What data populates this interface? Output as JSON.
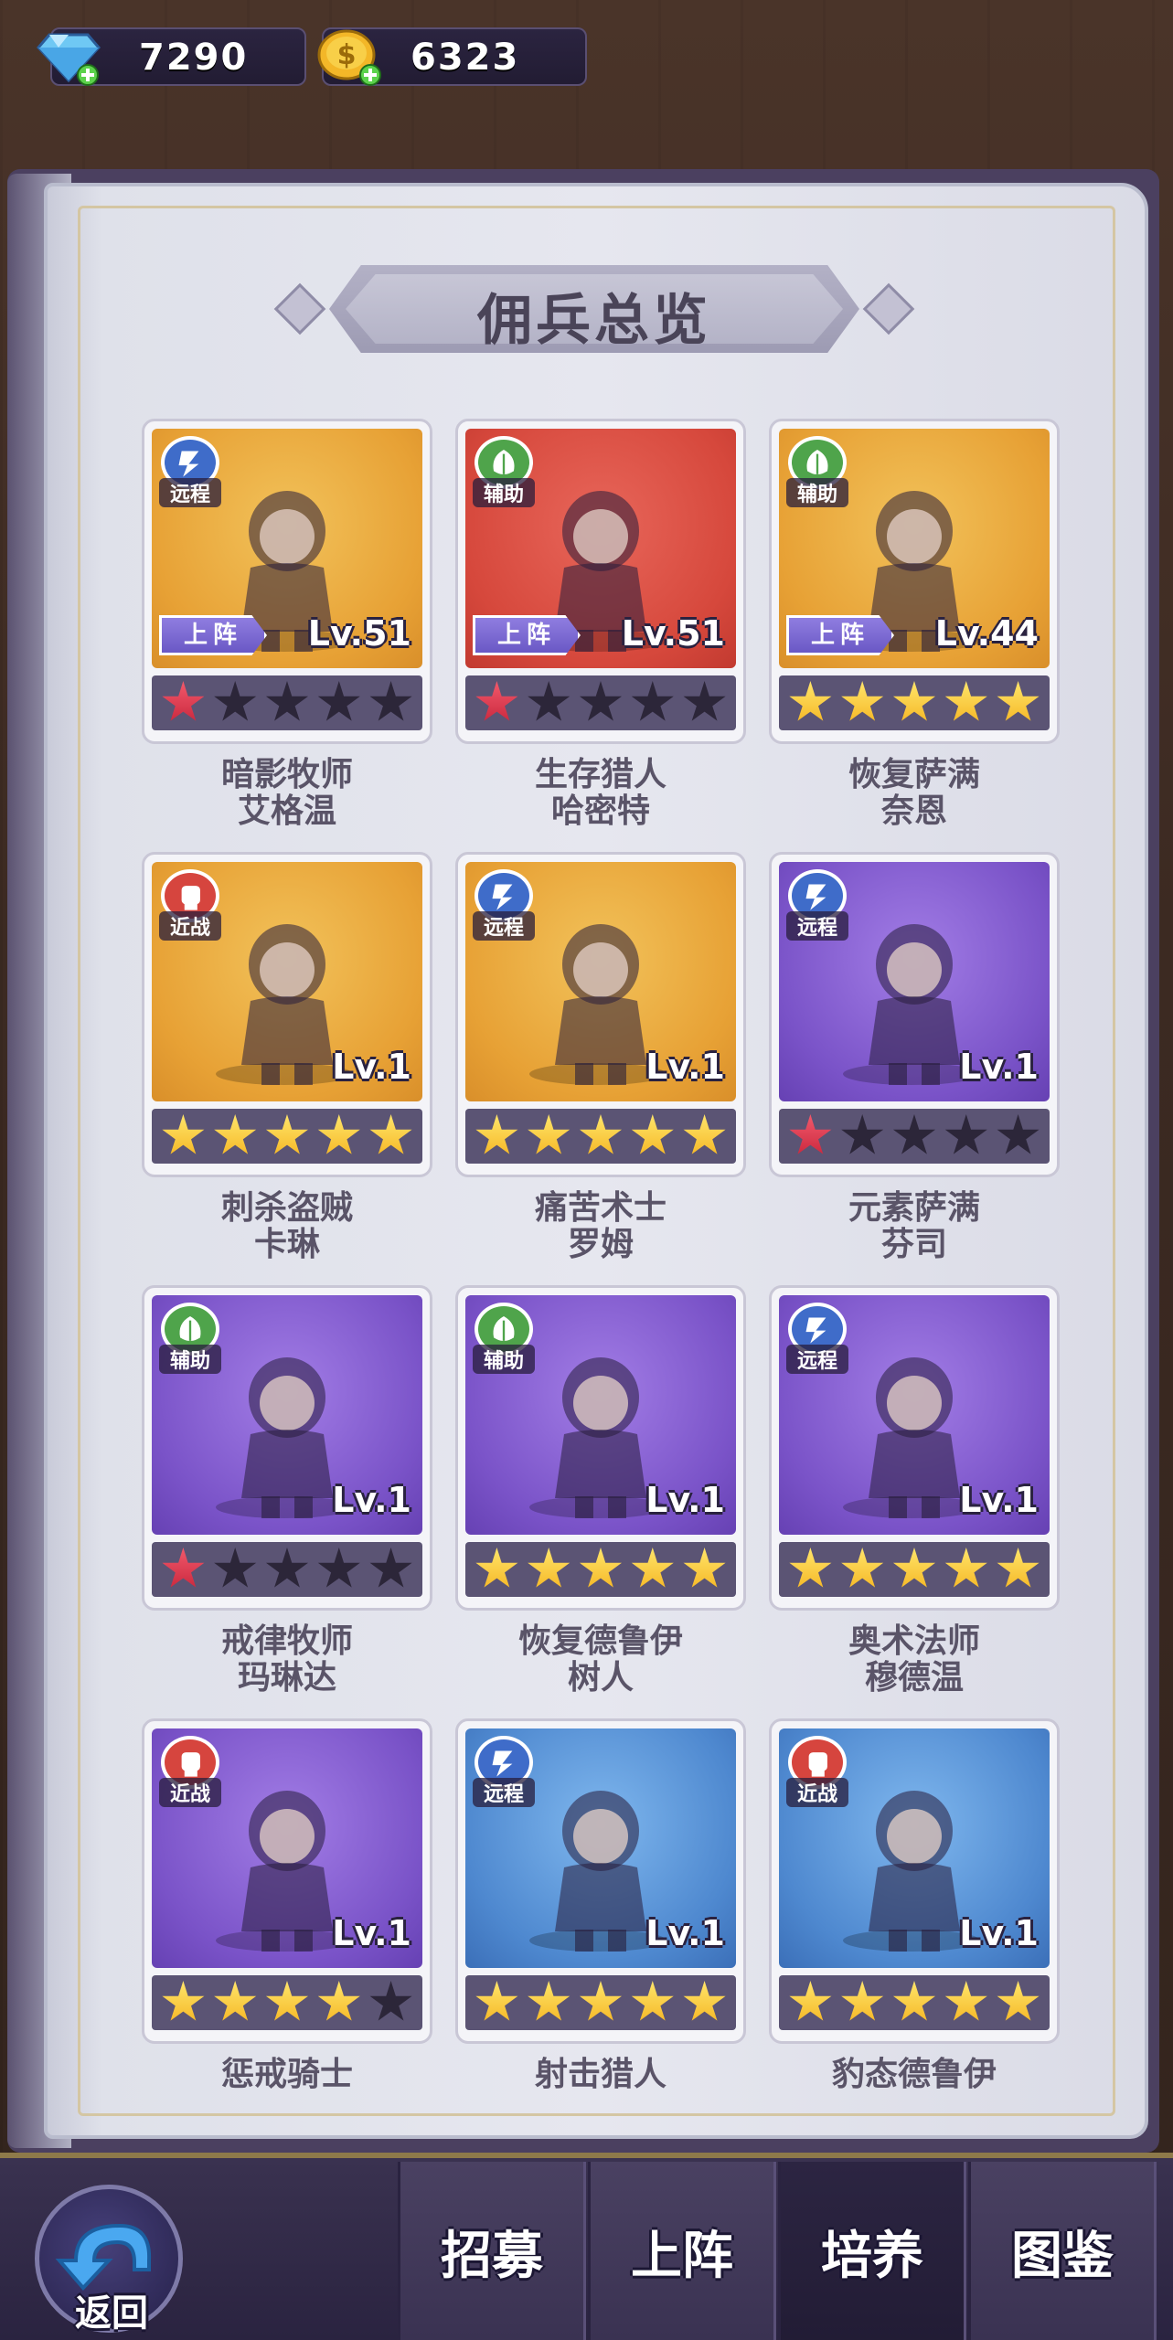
{
  "resources": {
    "gems": "7290",
    "gold": "6323"
  },
  "title": "佣兵总览",
  "cards": [
    {
      "role": "ranged",
      "role_label": "远程",
      "bg": "orange",
      "level": "Lv.51",
      "deployed": true,
      "stars": "red",
      "star_count": 1,
      "name": [
        "暗影牧师",
        "艾格温"
      ]
    },
    {
      "role": "support",
      "role_label": "辅助",
      "bg": "red",
      "level": "Lv.51",
      "deployed": true,
      "stars": "red",
      "star_count": 1,
      "name": [
        "生存猎人",
        "哈密特"
      ]
    },
    {
      "role": "support",
      "role_label": "辅助",
      "bg": "orange",
      "level": "Lv.44",
      "deployed": true,
      "stars": "gold",
      "star_count": 5,
      "name": [
        "恢复萨满",
        "奈恩"
      ]
    },
    {
      "role": "melee",
      "role_label": "近战",
      "bg": "orange",
      "level": "Lv.1",
      "deployed": false,
      "stars": "gold",
      "star_count": 5,
      "name": [
        "刺杀盗贼",
        "卡琳"
      ]
    },
    {
      "role": "ranged",
      "role_label": "远程",
      "bg": "orange",
      "level": "Lv.1",
      "deployed": false,
      "stars": "gold",
      "star_count": 5,
      "name": [
        "痛苦术士",
        "罗姆"
      ]
    },
    {
      "role": "ranged",
      "role_label": "远程",
      "bg": "purple",
      "level": "Lv.1",
      "deployed": false,
      "stars": "red",
      "star_count": 1,
      "name": [
        "元素萨满",
        "芬司"
      ]
    },
    {
      "role": "support",
      "role_label": "辅助",
      "bg": "purple",
      "level": "Lv.1",
      "deployed": false,
      "stars": "red",
      "star_count": 1,
      "name": [
        "戒律牧师",
        "玛琳达"
      ]
    },
    {
      "role": "support",
      "role_label": "辅助",
      "bg": "purple",
      "level": "Lv.1",
      "deployed": false,
      "stars": "gold",
      "star_count": 5,
      "name": [
        "恢复德鲁伊",
        "树人"
      ]
    },
    {
      "role": "ranged",
      "role_label": "远程",
      "bg": "purple",
      "level": "Lv.1",
      "deployed": false,
      "stars": "gold",
      "star_count": 5,
      "name": [
        "奥术法师",
        "穆德温"
      ]
    },
    {
      "role": "melee",
      "role_label": "近战",
      "bg": "purple",
      "level": "Lv.1",
      "deployed": false,
      "stars": "gold",
      "star_count": 4,
      "name": [
        "惩戒骑士"
      ]
    },
    {
      "role": "ranged",
      "role_label": "远程",
      "bg": "blue",
      "level": "Lv.1",
      "deployed": false,
      "stars": "gold",
      "star_count": 5,
      "name": [
        "射击猎人"
      ]
    },
    {
      "role": "melee",
      "role_label": "近战",
      "bg": "blue",
      "level": "Lv.1",
      "deployed": false,
      "stars": "gold",
      "star_count": 5,
      "name": [
        "豹态德鲁伊"
      ]
    }
  ],
  "deploy_label": "上阵",
  "nav": {
    "back": "返回",
    "tabs": [
      "招募",
      "上阵",
      "培养",
      "图鉴"
    ],
    "active_tab": 2
  },
  "colors": {
    "orange_bg": "#e7a135",
    "red_bg": "#d6483c",
    "purple_bg": "#7a53c8",
    "blue_bg": "#4e88cf",
    "ranged": "#3f6cc9",
    "support": "#4fa44b",
    "melee": "#d6453e"
  }
}
